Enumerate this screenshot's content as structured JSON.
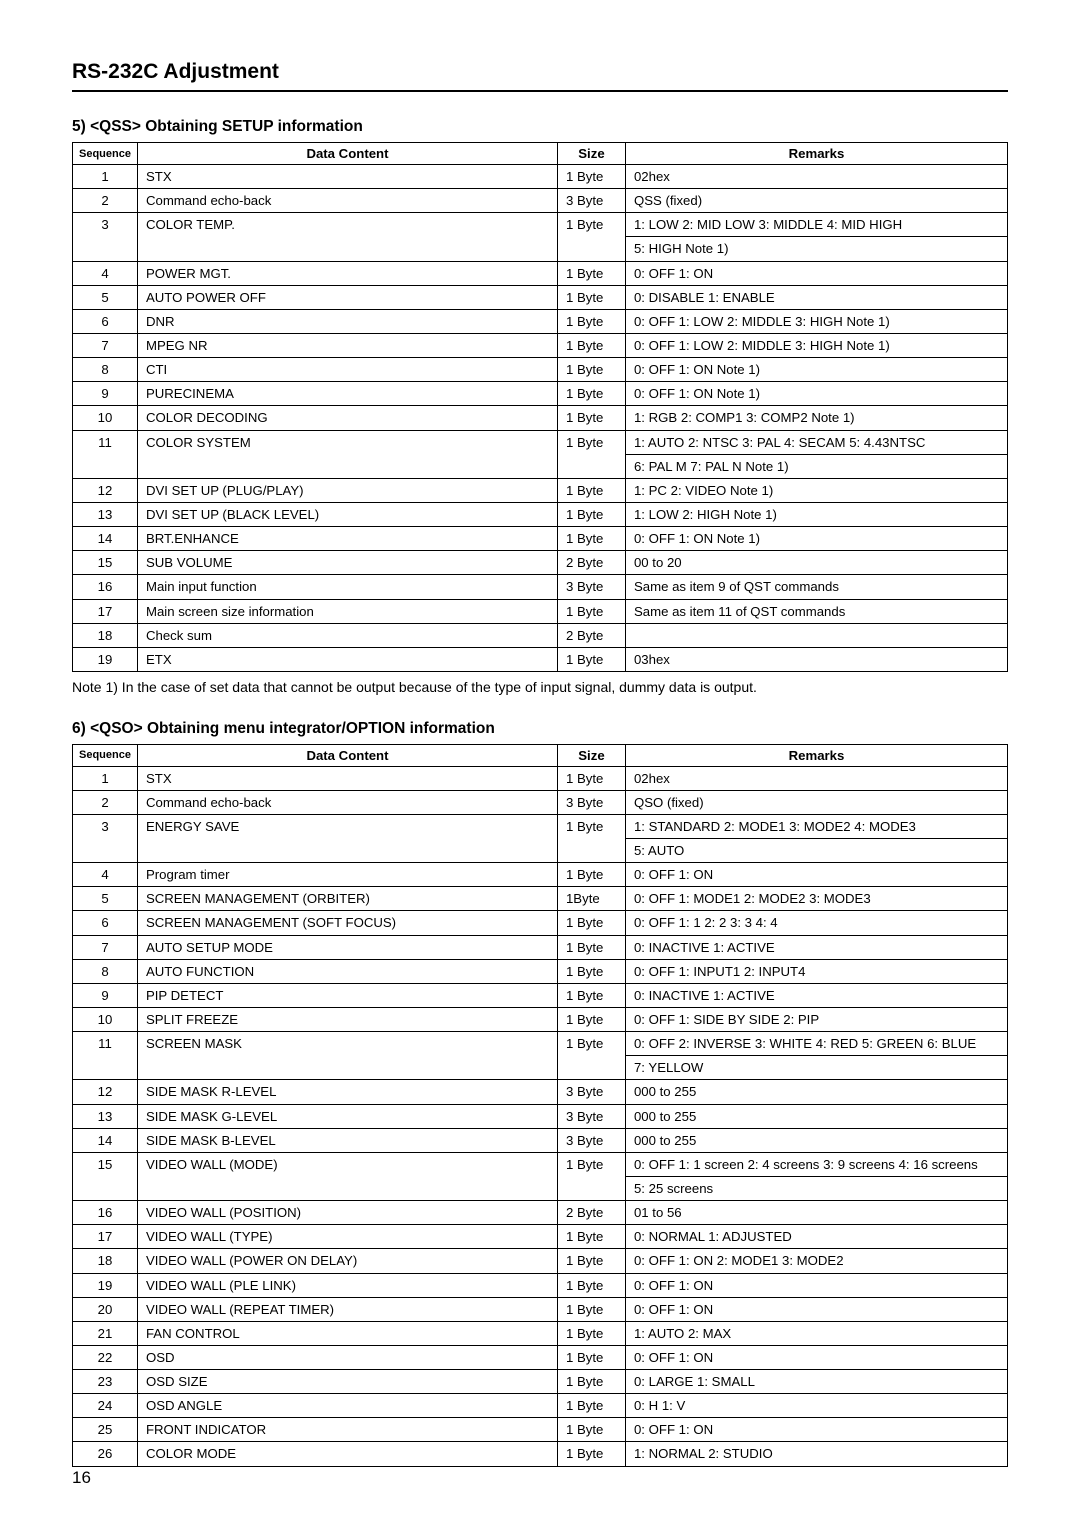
{
  "page_title": "RS-232C Adjustment",
  "page_number": "16",
  "section5": {
    "heading": "5) <QSS> Obtaining SETUP information",
    "headers": {
      "seq": "Sequence",
      "dc": "Data Content",
      "sz": "Size",
      "rm": "Remarks"
    },
    "rows": [
      {
        "seq": "1",
        "dc": "STX",
        "sz": "1 Byte",
        "rm": "02hex"
      },
      {
        "seq": "2",
        "dc": "Command echo-back",
        "sz": "3 Byte",
        "rm": "QSS (fixed)"
      },
      {
        "seq": "3",
        "dc": "COLOR TEMP.",
        "sz": "1 Byte",
        "rm": "1: LOW   2: MID LOW    3: MIDDLE    4: MID HIGH\n5: HIGH   Note 1)"
      },
      {
        "seq": "4",
        "dc": "POWER MGT.",
        "sz": "1 Byte",
        "rm": "0: OFF      1: ON"
      },
      {
        "seq": "5",
        "dc": "AUTO POWER OFF",
        "sz": "1 Byte",
        "rm": "0: DISABLE     1: ENABLE"
      },
      {
        "seq": "6",
        "dc": "DNR",
        "sz": "1 Byte",
        "rm": "0: OFF      1: LOW      2: MIDDLE       3: HIGH   Note 1)"
      },
      {
        "seq": "7",
        "dc": "MPEG NR",
        "sz": "1 Byte",
        "rm": "0: OFF      1: LOW      2: MIDDLE       3: HIGH   Note 1)"
      },
      {
        "seq": "8",
        "dc": "CTI",
        "sz": "1 Byte",
        "rm": "0: OFF      1: ON   Note 1)"
      },
      {
        "seq": "9",
        "dc": "PURECINEMA",
        "sz": "1 Byte",
        "rm": "0: OFF      1: ON    Note 1)"
      },
      {
        "seq": "10",
        "dc": "COLOR DECODING",
        "sz": "1 Byte",
        "rm": "1: RGB    2: COMP1    3: COMP2  Note 1)"
      },
      {
        "seq": "11",
        "dc": "COLOR SYSTEM",
        "sz": "1 Byte",
        "rm": "1: AUTO      2: NTSC      3: PAL     4: SECAM      5: 4.43NTSC\n6: PAL M     7: PAL N   Note 1)"
      },
      {
        "seq": "12",
        "dc": "DVI SET UP (PLUG/PLAY)",
        "sz": "1 Byte",
        "rm": "1: PC       2: VIDEO    Note 1)"
      },
      {
        "seq": "13",
        "dc": "DVI SET UP (BLACK LEVEL)",
        "sz": "1 Byte",
        "rm": "1: LOW   2: HIGH     Note 1)"
      },
      {
        "seq": "14",
        "dc": "BRT.ENHANCE",
        "sz": "1 Byte",
        "rm": "0: OFF      1: ON     Note 1)"
      },
      {
        "seq": "15",
        "dc": "SUB VOLUME",
        "sz": "2 Byte",
        "rm": "00 to 20"
      },
      {
        "seq": "16",
        "dc": "Main input function",
        "sz": "3 Byte",
        "rm": "Same as item 9 of QST commands"
      },
      {
        "seq": "17",
        "dc": "Main screen size information",
        "sz": "1 Byte",
        "rm": "Same as item 11 of QST commands"
      },
      {
        "seq": "18",
        "dc": "Check sum",
        "sz": "2 Byte",
        "rm": ""
      },
      {
        "seq": "19",
        "dc": "ETX",
        "sz": "1 Byte",
        "rm": "03hex"
      }
    ],
    "note": "Note 1)  In the case of set data that cannot be output because of the type of input signal, dummy data is output."
  },
  "section6": {
    "heading": "6)  <QSO> Obtaining menu integrator/OPTION information",
    "headers": {
      "seq": "Sequence",
      "dc": "Data Content",
      "sz": "Size",
      "rm": "Remarks"
    },
    "rows": [
      {
        "seq": "1",
        "dc": "STX",
        "sz": "1 Byte",
        "rm": "02hex"
      },
      {
        "seq": "2",
        "dc": "Command echo-back",
        "sz": "3 Byte",
        "rm": "QSO (fixed)"
      },
      {
        "seq": "3",
        "dc": "ENERGY SAVE",
        "sz": "1 Byte",
        "rm": "1: STANDARD     2: MODE1     3: MODE2     4: MODE3\n5: AUTO"
      },
      {
        "seq": "4",
        "dc": "Program timer",
        "sz": "1 Byte",
        "rm": "0: OFF      1: ON"
      },
      {
        "seq": "5",
        "dc": "SCREEN MANAGEMENT (ORBITER)",
        "sz": "1Byte",
        "rm": "0: OFF     1: MODE1     2: MODE2     3: MODE3"
      },
      {
        "seq": "6",
        "dc": "SCREEN MANAGEMENT (SOFT FOCUS)",
        "sz": "1 Byte",
        "rm": "0: OFF     1: 1     2: 2     3: 3      4: 4"
      },
      {
        "seq": "7",
        "dc": "AUTO SETUP MODE",
        "sz": "1 Byte",
        "rm": "0: INACTIVE   1: ACTIVE"
      },
      {
        "seq": "8",
        "dc": "AUTO FUNCTION",
        "sz": "1 Byte",
        "rm": "0: OFF    1: INPUT1    2: INPUT4"
      },
      {
        "seq": "9",
        "dc": "PIP DETECT",
        "sz": "1 Byte",
        "rm": "0: INACTIVE    1: ACTIVE"
      },
      {
        "seq": "10",
        "dc": "SPLIT FREEZE",
        "sz": "1 Byte",
        "rm": "0: OFF    1: SIDE BY SIDE    2: PIP"
      },
      {
        "seq": "11",
        "dc": "SCREEN MASK",
        "sz": "1 Byte",
        "rm": "0: OFF    2: INVERSE    3: WHITE    4: RED    5: GREEN    6: BLUE\n7: YELLOW"
      },
      {
        "seq": "12",
        "dc": "SIDE MASK R-LEVEL",
        "sz": "3 Byte",
        "rm": "000 to 255"
      },
      {
        "seq": "13",
        "dc": "SIDE MASK G-LEVEL",
        "sz": "3 Byte",
        "rm": "000 to 255"
      },
      {
        "seq": "14",
        "dc": "SIDE MASK B-LEVEL",
        "sz": "3 Byte",
        "rm": "000 to 255"
      },
      {
        "seq": "15",
        "dc": "VIDEO WALL (MODE)",
        "sz": "1 Byte",
        "rm": "0: OFF    1: 1 screen    2: 4 screens    3: 9 screens    4: 16 screens\n5: 25 screens"
      },
      {
        "seq": "16",
        "dc": "VIDEO WALL (POSITION)",
        "sz": "2 Byte",
        "rm": "01 to 56"
      },
      {
        "seq": "17",
        "dc": "VIDEO WALL (TYPE)",
        "sz": "1 Byte",
        "rm": "0: NORMAL    1: ADJUSTED"
      },
      {
        "seq": "18",
        "dc": "VIDEO WALL (POWER ON DELAY)",
        "sz": "1 Byte",
        "rm": "0: OFF            1: ON      2: MODE1      3: MODE2"
      },
      {
        "seq": "19",
        "dc": "VIDEO WALL (PLE LINK)",
        "sz": "1 Byte",
        "rm": "0: OFF            1: ON"
      },
      {
        "seq": "20",
        "dc": "VIDEO WALL (REPEAT TIMER)",
        "sz": "1 Byte",
        "rm": "0: OFF            1: ON"
      },
      {
        "seq": "21",
        "dc": "FAN CONTROL",
        "sz": "1 Byte",
        "rm": "1: AUTO         2: MAX"
      },
      {
        "seq": "22",
        "dc": "OSD",
        "sz": "1 Byte",
        "rm": "0: OFF            1: ON"
      },
      {
        "seq": "23",
        "dc": "OSD SIZE",
        "sz": "1 Byte",
        "rm": "0: LARGE        1: SMALL"
      },
      {
        "seq": "24",
        "dc": "OSD ANGLE",
        "sz": "1 Byte",
        "rm": "0: H               1: V"
      },
      {
        "seq": "25",
        "dc": "FRONT INDICATOR",
        "sz": "1 Byte",
        "rm": "0: OFF            1: ON"
      },
      {
        "seq": "26",
        "dc": "COLOR MODE",
        "sz": "1 Byte",
        "rm": "1: NORMAL   2: STUDIO"
      }
    ]
  }
}
